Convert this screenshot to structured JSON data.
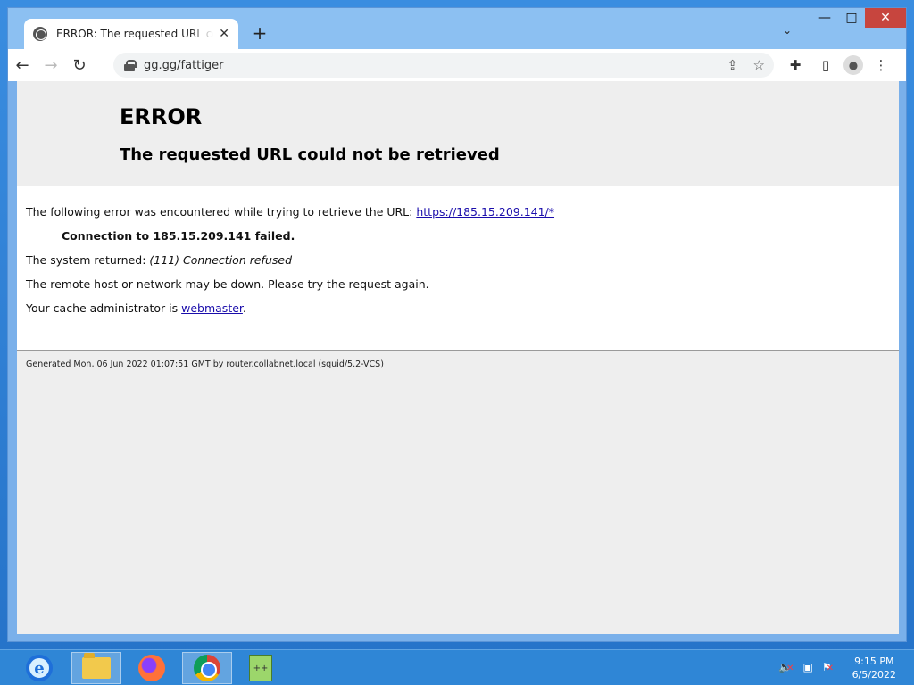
{
  "browser": {
    "tab": {
      "title": "ERROR: The requested URL could not be retrieved",
      "icon": "globe-icon"
    },
    "address_bar": {
      "url": "gg.gg/fattiger"
    },
    "window_controls": {
      "minimize": "—",
      "maximize": "□",
      "close": "✕"
    }
  },
  "page": {
    "heading": "ERROR",
    "subheading": "The requested URL could not be retrieved",
    "intro_text": "The following error was encountered while trying to retrieve the URL: ",
    "intro_link": "https://185.15.209.141/*",
    "failure": "Connection to 185.15.209.141 failed.",
    "system_returned_label": "The system returned: ",
    "system_returned_value": "(111) Connection refused",
    "remote_host_text": "The remote host or network may be down. Please try the request again.",
    "cache_admin_text": "Your cache administrator is ",
    "cache_admin_link": "webmaster",
    "cache_admin_suffix": ".",
    "footer": "Generated Mon, 06 Jun 2022 01:07:51 GMT by router.collabnet.local (squid/5.2-VCS)"
  },
  "taskbar": {
    "apps": [
      "internet-explorer",
      "file-explorer",
      "firefox",
      "chrome",
      "notepad-plus-plus"
    ],
    "active_app": "chrome",
    "clock": {
      "time": "9:15 PM",
      "date": "6/5/2022"
    }
  },
  "colors": {
    "link": "#1a0dab",
    "page_bg": "#eeeeee",
    "taskbar": "#2f86d6",
    "close_button": "#c7453e"
  }
}
